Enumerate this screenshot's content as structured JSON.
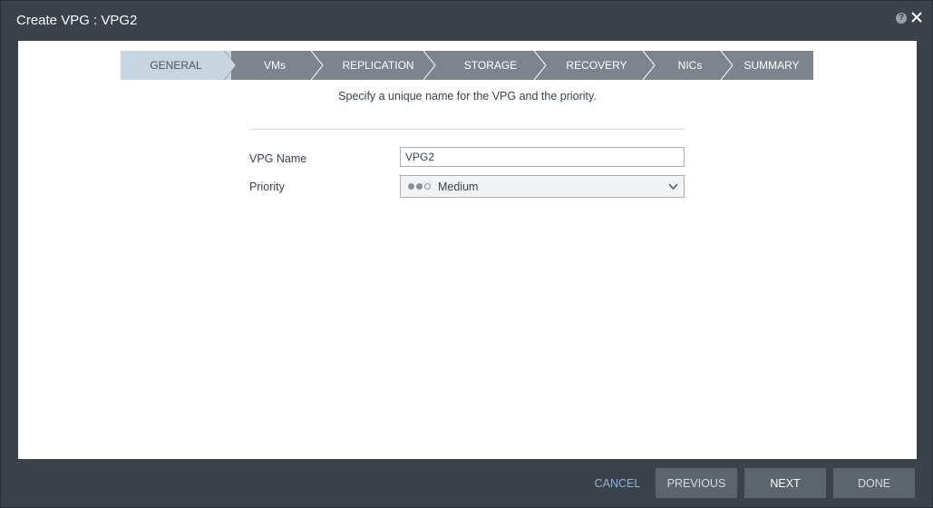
{
  "dialog": {
    "title": "Create VPG : VPG2",
    "help_icon": "question-circle-icon",
    "close_icon": "close-icon"
  },
  "wizard": {
    "steps": [
      {
        "label": "GENERAL",
        "active": true
      },
      {
        "label": "VMs",
        "active": false
      },
      {
        "label": "REPLICATION",
        "active": false
      },
      {
        "label": "STORAGE",
        "active": false
      },
      {
        "label": "RECOVERY",
        "active": false
      },
      {
        "label": "NICs",
        "active": false
      },
      {
        "label": "SUMMARY",
        "active": false
      }
    ]
  },
  "form": {
    "instruction": "Specify a unique name for the VPG and the priority.",
    "vpg_name_label": "VPG Name",
    "vpg_name_value": "VPG2",
    "priority_label": "Priority",
    "priority_value": "Medium",
    "priority_level": 2,
    "priority_max": 3
  },
  "footer": {
    "cancel_label": "CANCEL",
    "previous_label": "PREVIOUS",
    "next_label": "NEXT",
    "done_label": "DONE"
  },
  "colors": {
    "background": "#3b424c",
    "active_step": "#c6d5e0",
    "inactive_step": "#7d848d",
    "button": "#5c646e",
    "cancel_link": "#8fb4cf"
  }
}
